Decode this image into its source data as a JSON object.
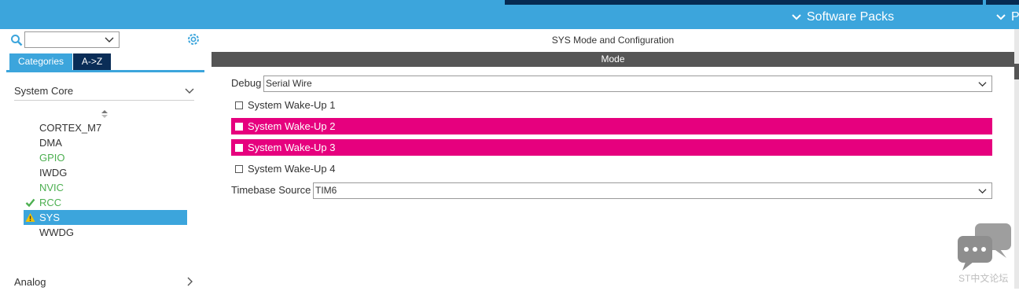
{
  "top_bar": {
    "software_packs_label": "Software Packs",
    "next_menu_label": "P"
  },
  "sidebar": {
    "search": {
      "value": ""
    },
    "tabs": {
      "categories_label": "Categories",
      "az_label": "A->Z"
    },
    "section_system_core": "System Core",
    "section_analog": "Analog",
    "items": [
      {
        "label": "CORTEX_M7",
        "status": "none"
      },
      {
        "label": "DMA",
        "status": "none"
      },
      {
        "label": "GPIO",
        "status": "configured"
      },
      {
        "label": "IWDG",
        "status": "none"
      },
      {
        "label": "NVIC",
        "status": "configured"
      },
      {
        "label": "RCC",
        "status": "ok"
      },
      {
        "label": "SYS",
        "status": "warning"
      },
      {
        "label": "WWDG",
        "status": "none"
      }
    ]
  },
  "main": {
    "title": "SYS Mode and Configuration",
    "mode_bar_label": "Mode",
    "debug": {
      "label": "Debug",
      "value": "Serial Wire"
    },
    "wakeups": [
      {
        "label": "System Wake-Up 1",
        "highlighted": false,
        "checked": false
      },
      {
        "label": "System Wake-Up 2",
        "highlighted": true,
        "checked": false
      },
      {
        "label": "System Wake-Up 3",
        "highlighted": true,
        "checked": false
      },
      {
        "label": "System Wake-Up 4",
        "highlighted": false,
        "checked": false
      }
    ],
    "timebase": {
      "label": "Timebase Source",
      "value": "TIM6"
    }
  },
  "watermark": {
    "text": "ST中文论坛"
  },
  "colors": {
    "accent": "#3ca5dc",
    "navy": "#0a2d57",
    "highlight": "#e6007e",
    "configured": "#4caf50",
    "warning": "#f2c200"
  }
}
